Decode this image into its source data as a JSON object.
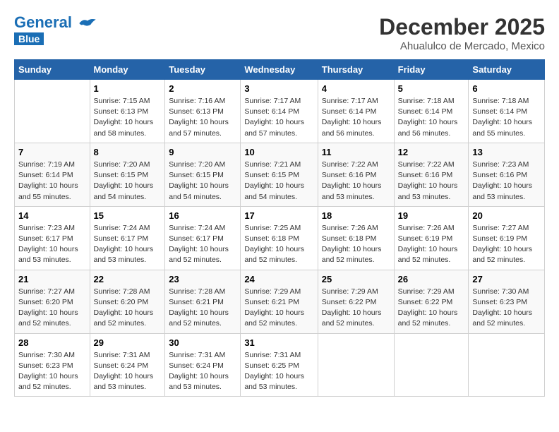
{
  "header": {
    "logo_line1": "General",
    "logo_line2": "Blue",
    "month": "December 2025",
    "location": "Ahualulco de Mercado, Mexico"
  },
  "days_of_week": [
    "Sunday",
    "Monday",
    "Tuesday",
    "Wednesday",
    "Thursday",
    "Friday",
    "Saturday"
  ],
  "weeks": [
    [
      {
        "num": "",
        "detail": ""
      },
      {
        "num": "1",
        "detail": "Sunrise: 7:15 AM\nSunset: 6:13 PM\nDaylight: 10 hours\nand 58 minutes."
      },
      {
        "num": "2",
        "detail": "Sunrise: 7:16 AM\nSunset: 6:13 PM\nDaylight: 10 hours\nand 57 minutes."
      },
      {
        "num": "3",
        "detail": "Sunrise: 7:17 AM\nSunset: 6:14 PM\nDaylight: 10 hours\nand 57 minutes."
      },
      {
        "num": "4",
        "detail": "Sunrise: 7:17 AM\nSunset: 6:14 PM\nDaylight: 10 hours\nand 56 minutes."
      },
      {
        "num": "5",
        "detail": "Sunrise: 7:18 AM\nSunset: 6:14 PM\nDaylight: 10 hours\nand 56 minutes."
      },
      {
        "num": "6",
        "detail": "Sunrise: 7:18 AM\nSunset: 6:14 PM\nDaylight: 10 hours\nand 55 minutes."
      }
    ],
    [
      {
        "num": "7",
        "detail": "Sunrise: 7:19 AM\nSunset: 6:14 PM\nDaylight: 10 hours\nand 55 minutes."
      },
      {
        "num": "8",
        "detail": "Sunrise: 7:20 AM\nSunset: 6:15 PM\nDaylight: 10 hours\nand 54 minutes."
      },
      {
        "num": "9",
        "detail": "Sunrise: 7:20 AM\nSunset: 6:15 PM\nDaylight: 10 hours\nand 54 minutes."
      },
      {
        "num": "10",
        "detail": "Sunrise: 7:21 AM\nSunset: 6:15 PM\nDaylight: 10 hours\nand 54 minutes."
      },
      {
        "num": "11",
        "detail": "Sunrise: 7:22 AM\nSunset: 6:16 PM\nDaylight: 10 hours\nand 53 minutes."
      },
      {
        "num": "12",
        "detail": "Sunrise: 7:22 AM\nSunset: 6:16 PM\nDaylight: 10 hours\nand 53 minutes."
      },
      {
        "num": "13",
        "detail": "Sunrise: 7:23 AM\nSunset: 6:16 PM\nDaylight: 10 hours\nand 53 minutes."
      }
    ],
    [
      {
        "num": "14",
        "detail": "Sunrise: 7:23 AM\nSunset: 6:17 PM\nDaylight: 10 hours\nand 53 minutes."
      },
      {
        "num": "15",
        "detail": "Sunrise: 7:24 AM\nSunset: 6:17 PM\nDaylight: 10 hours\nand 53 minutes."
      },
      {
        "num": "16",
        "detail": "Sunrise: 7:24 AM\nSunset: 6:17 PM\nDaylight: 10 hours\nand 52 minutes."
      },
      {
        "num": "17",
        "detail": "Sunrise: 7:25 AM\nSunset: 6:18 PM\nDaylight: 10 hours\nand 52 minutes."
      },
      {
        "num": "18",
        "detail": "Sunrise: 7:26 AM\nSunset: 6:18 PM\nDaylight: 10 hours\nand 52 minutes."
      },
      {
        "num": "19",
        "detail": "Sunrise: 7:26 AM\nSunset: 6:19 PM\nDaylight: 10 hours\nand 52 minutes."
      },
      {
        "num": "20",
        "detail": "Sunrise: 7:27 AM\nSunset: 6:19 PM\nDaylight: 10 hours\nand 52 minutes."
      }
    ],
    [
      {
        "num": "21",
        "detail": "Sunrise: 7:27 AM\nSunset: 6:20 PM\nDaylight: 10 hours\nand 52 minutes."
      },
      {
        "num": "22",
        "detail": "Sunrise: 7:28 AM\nSunset: 6:20 PM\nDaylight: 10 hours\nand 52 minutes."
      },
      {
        "num": "23",
        "detail": "Sunrise: 7:28 AM\nSunset: 6:21 PM\nDaylight: 10 hours\nand 52 minutes."
      },
      {
        "num": "24",
        "detail": "Sunrise: 7:29 AM\nSunset: 6:21 PM\nDaylight: 10 hours\nand 52 minutes."
      },
      {
        "num": "25",
        "detail": "Sunrise: 7:29 AM\nSunset: 6:22 PM\nDaylight: 10 hours\nand 52 minutes."
      },
      {
        "num": "26",
        "detail": "Sunrise: 7:29 AM\nSunset: 6:22 PM\nDaylight: 10 hours\nand 52 minutes."
      },
      {
        "num": "27",
        "detail": "Sunrise: 7:30 AM\nSunset: 6:23 PM\nDaylight: 10 hours\nand 52 minutes."
      }
    ],
    [
      {
        "num": "28",
        "detail": "Sunrise: 7:30 AM\nSunset: 6:23 PM\nDaylight: 10 hours\nand 52 minutes."
      },
      {
        "num": "29",
        "detail": "Sunrise: 7:31 AM\nSunset: 6:24 PM\nDaylight: 10 hours\nand 53 minutes."
      },
      {
        "num": "30",
        "detail": "Sunrise: 7:31 AM\nSunset: 6:24 PM\nDaylight: 10 hours\nand 53 minutes."
      },
      {
        "num": "31",
        "detail": "Sunrise: 7:31 AM\nSunset: 6:25 PM\nDaylight: 10 hours\nand 53 minutes."
      },
      {
        "num": "",
        "detail": ""
      },
      {
        "num": "",
        "detail": ""
      },
      {
        "num": "",
        "detail": ""
      }
    ]
  ]
}
